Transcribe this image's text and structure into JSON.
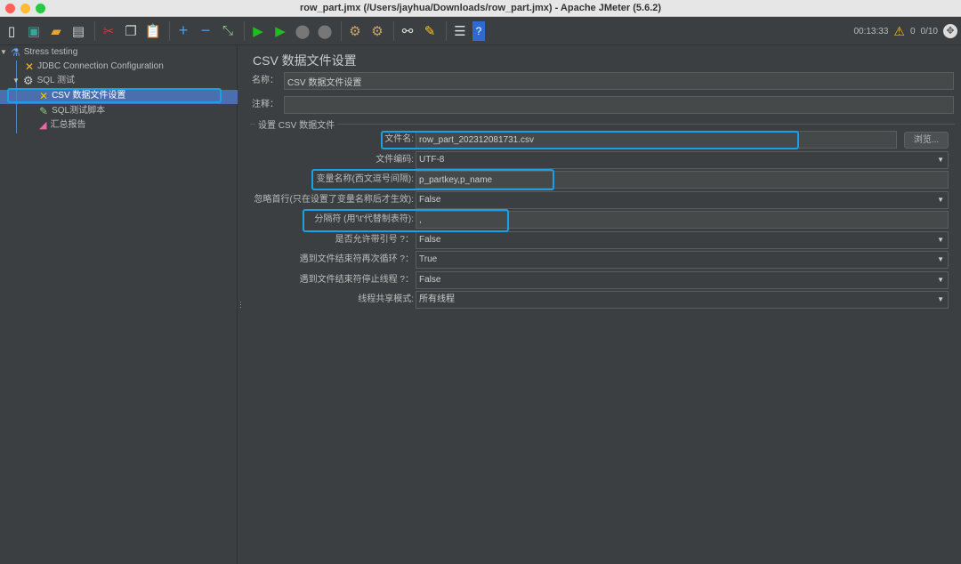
{
  "window": {
    "title": "row_part.jmx (/Users/jayhua/Downloads/row_part.jmx) - Apache JMeter (5.6.2)"
  },
  "toolbar": {
    "icons": [
      "new-icon",
      "templates-icon",
      "open-icon",
      "save-icon",
      "cut-icon",
      "copy-icon",
      "paste-icon",
      "expand-icon",
      "collapse-icon",
      "toggle-icon",
      "start-icon",
      "start-no-pause-icon",
      "stop-icon",
      "shutdown-icon",
      "clear-icon",
      "clear-all-icon",
      "search-icon",
      "reset-search-icon",
      "function-helper-icon",
      "help-icon"
    ]
  },
  "status": {
    "elapsed": "00:13:33",
    "warnings": "0",
    "threads": "0/10"
  },
  "tree": {
    "items": [
      {
        "label": "Stress testing"
      },
      {
        "label": "JDBC Connection Configuration"
      },
      {
        "label": "SQL 测试"
      },
      {
        "label": "CSV 数据文件设置"
      },
      {
        "label": "SQL测试脚本"
      },
      {
        "label": "汇总报告"
      }
    ]
  },
  "panel": {
    "title": "CSV 数据文件设置",
    "name_label": "名称：",
    "name_value": "CSV 数据文件设置",
    "comment_label": "注释：",
    "comment_value": "",
    "group_label": "设置 CSV 数据文件",
    "browse_label": "浏览...",
    "rows": [
      {
        "label": "文件名:",
        "value": "row_part_202312081731.csv"
      },
      {
        "label": "文件编码:",
        "value": "UTF-8"
      },
      {
        "label": "变量名称(西文逗号间隔):",
        "value": "p_partkey,p_name"
      },
      {
        "label": "忽略首行(只在设置了变量名称后才生效):",
        "value": "False"
      },
      {
        "label": "分隔符 (用'\\t'代替制表符):",
        "value": ","
      },
      {
        "label": "是否允许带引号 ?：",
        "value": "False"
      },
      {
        "label": "遇到文件结束符再次循环 ?：",
        "value": "True"
      },
      {
        "label": "遇到文件结束符停止线程 ?：",
        "value": "False"
      },
      {
        "label": "线程共享模式:",
        "value": "所有线程"
      }
    ]
  }
}
